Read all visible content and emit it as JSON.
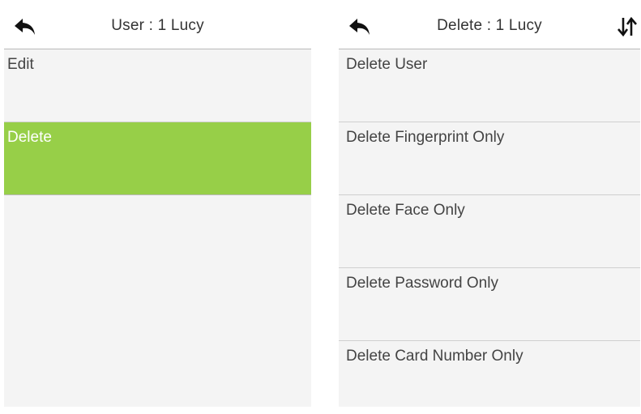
{
  "left_screen": {
    "header": {
      "title": "User : 1 Lucy",
      "back_icon": "back-arrow-icon"
    },
    "items": [
      {
        "label": "Edit"
      },
      {
        "label": "Delete"
      }
    ],
    "selected_color": "#97cf48"
  },
  "right_screen": {
    "header": {
      "title": "Delete : 1 Lucy",
      "back_icon": "back-arrow-icon",
      "sort_icon": "sort-arrows-icon"
    },
    "items": [
      {
        "label": "Delete User"
      },
      {
        "label": "Delete Fingerprint Only"
      },
      {
        "label": "Delete Face Only"
      },
      {
        "label": "Delete Password Only"
      },
      {
        "label": "Delete Card Number Only"
      }
    ]
  }
}
